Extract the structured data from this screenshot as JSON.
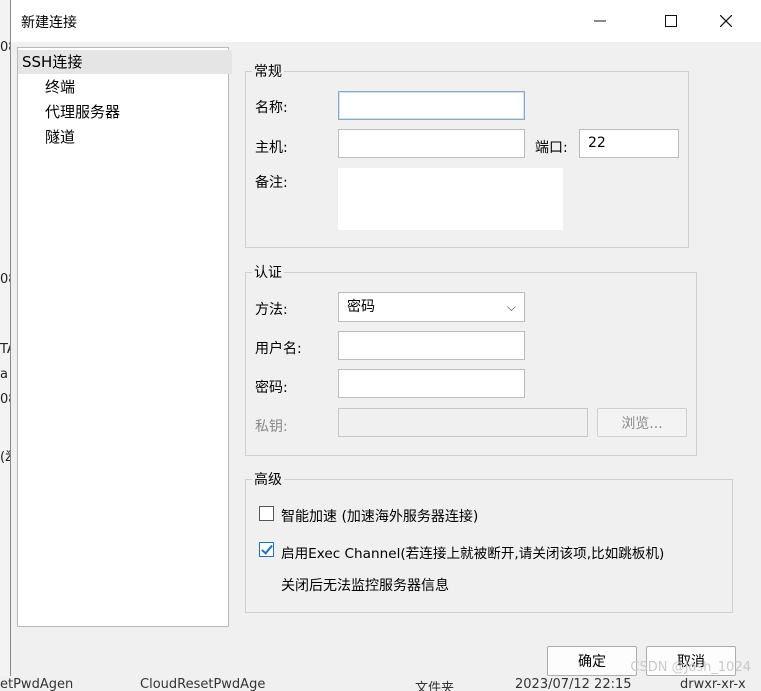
{
  "dialog": {
    "title": "新建连接",
    "minimize_icon": "minimize-icon",
    "maximize_icon": "maximize-icon",
    "close_icon": "close-icon"
  },
  "tree": {
    "items": [
      {
        "label": "SSH连接",
        "selected": true
      },
      {
        "label": "终端"
      },
      {
        "label": "代理服务器"
      },
      {
        "label": "隧道"
      }
    ]
  },
  "general": {
    "title": "常规",
    "name_label": "名称:",
    "name_value": "",
    "host_label": "主机:",
    "host_value": "",
    "port_label": "端口:",
    "port_value": "22",
    "note_label": "备注:",
    "note_value": ""
  },
  "auth": {
    "title": "认证",
    "method_label": "方法:",
    "method_value": "密码",
    "username_label": "用户名:",
    "username_value": "",
    "password_label": "密码:",
    "password_value": "",
    "key_label": "私钥:",
    "key_value": "",
    "browse_label": "浏览..."
  },
  "advanced": {
    "title": "高级",
    "smart_accel_label": "智能加速 (加速海外服务器连接)",
    "smart_accel_checked": false,
    "exec_channel_label": "启用Exec Channel(若连接上就被断开,请关闭该项,比如跳板机)",
    "exec_channel_checked": true,
    "exec_channel_note": "关闭后无法监控服务器信息"
  },
  "footer": {
    "ok_label": "确定",
    "cancel_label": "取消"
  },
  "background": {
    "left_fragments": [
      "08",
      "08",
      "TA",
      "a",
      "08",
      "(ž"
    ],
    "bottom_texts": [
      "etPwdAgen",
      "CloudResetPwdAge",
      "文件夹",
      "2023/07/12 22:15",
      "drwxr-xr-x"
    ]
  },
  "watermark": "CSDN @Josh_1024"
}
